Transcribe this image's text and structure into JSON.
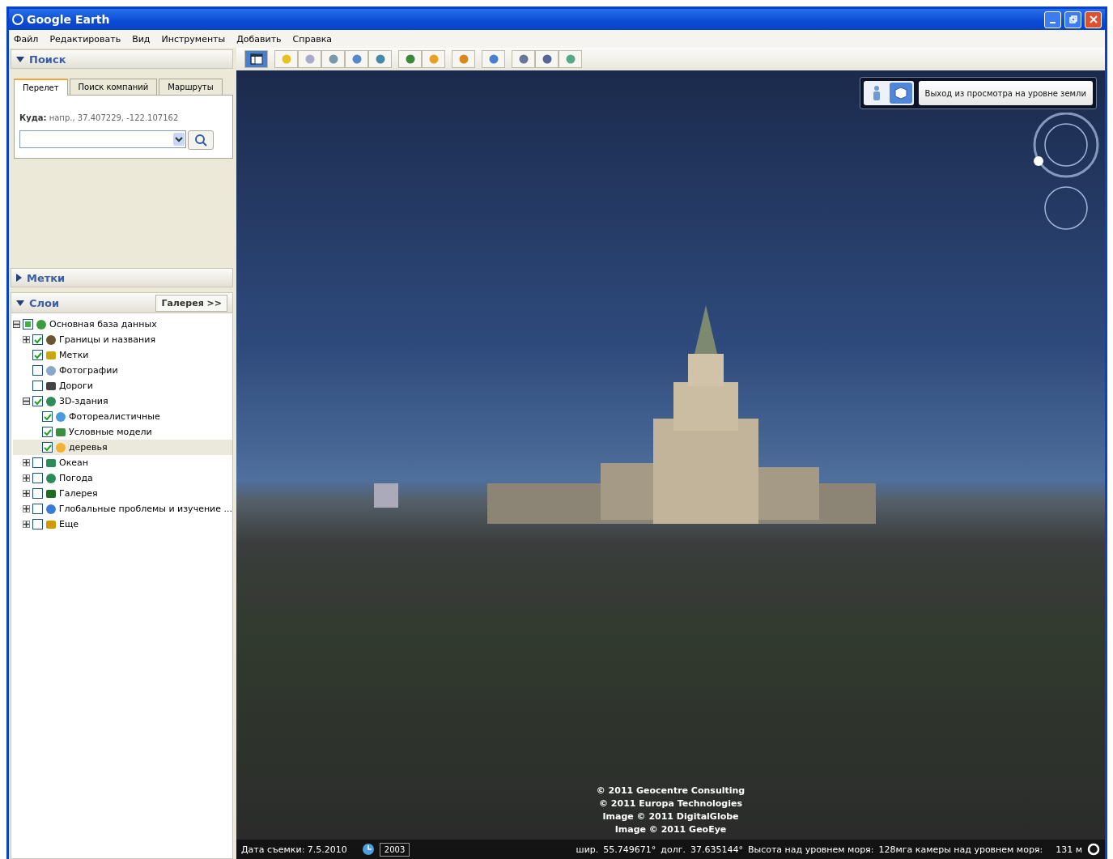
{
  "window": {
    "title": "Google Earth"
  },
  "menu": [
    "Файл",
    "Редактировать",
    "Вид",
    "Инструменты",
    "Добавить",
    "Справка"
  ],
  "search_panel": {
    "title": "Поиск",
    "expanded": true,
    "tabs": [
      {
        "label": "Перелет",
        "selected": true
      },
      {
        "label": "Поиск компаний",
        "selected": false
      },
      {
        "label": "Маршруты",
        "selected": false
      }
    ],
    "hint_label": "Куда:",
    "hint": "напр., 37.407229, -122.107162"
  },
  "places_panel": {
    "title": "Метки",
    "expanded": false
  },
  "layers_panel": {
    "title": "Слои",
    "expanded": true,
    "gallery_button": "Галерея >>",
    "tree": [
      {
        "label": "Основная база данных",
        "checked": true,
        "partial": true,
        "expanded": true,
        "selected": false,
        "children": [
          {
            "label": "Границы и названия",
            "checked": true,
            "expanded": false,
            "selected": false
          },
          {
            "label": "Метки",
            "checked": true,
            "selected": false
          },
          {
            "label": "Фотографии",
            "checked": false,
            "selected": false
          },
          {
            "label": "Дороги",
            "checked": false,
            "selected": false
          },
          {
            "label": "3D-здания",
            "checked": true,
            "expanded": true,
            "selected": false,
            "children": [
              {
                "label": "Фотореалистичные",
                "checked": true,
                "selected": false
              },
              {
                "label": "Условные модели",
                "checked": true,
                "selected": false
              },
              {
                "label": "деревья",
                "checked": true,
                "selected": true
              }
            ]
          },
          {
            "label": "Океан",
            "checked": false,
            "expanded": false,
            "selected": false
          },
          {
            "label": "Погода",
            "checked": false,
            "expanded": false,
            "selected": false
          },
          {
            "label": "Галерея",
            "checked": false,
            "expanded": false,
            "selected": false
          },
          {
            "label": "Глобальные проблемы и изучение ...",
            "checked": false,
            "expanded": false,
            "selected": false
          },
          {
            "label": "Еще",
            "checked": false,
            "expanded": false,
            "selected": false
          }
        ]
      }
    ]
  },
  "toolbar": {
    "sidebar_toggle_on": true
  },
  "view": {
    "view_modes": [
      {
        "selected": false
      },
      {
        "selected": true
      }
    ],
    "exit_button": "Выход из просмотра на уровне земли",
    "copyright": [
      "© 2011 Geocentre Consulting",
      "© 2011 Europa Technologies",
      "Image © 2011 DigitalGlobe",
      "Image © 2011 GeoEye"
    ]
  },
  "status_bar": {
    "date_label": "Дата съемки: 7.5.2010",
    "year": "2003",
    "lat_label": "шир.",
    "lat": "55.749671°",
    "lon_label": "долг.",
    "lon": "37.635144°",
    "elevation_label": "Высота над уровнем моря:",
    "overlap_text": "128мга камеры над уровнем моря:",
    "camera_alt": "131 м"
  }
}
